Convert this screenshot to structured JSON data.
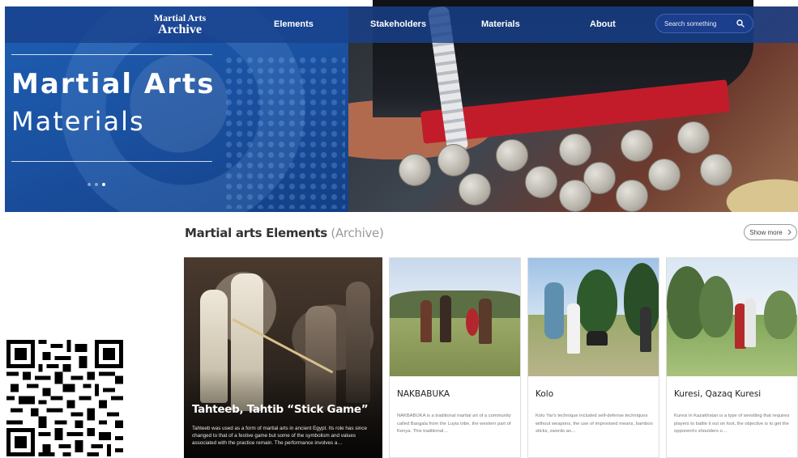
{
  "nav": {
    "logo_line1": "Martial Arts",
    "logo_line2": "Archive",
    "links": [
      "Elements",
      "Stakeholders",
      "Materials",
      "About"
    ],
    "search_placeholder": "Search something"
  },
  "hero": {
    "title_line1": "Martial Arts",
    "title_line2": "Materials",
    "slides": 3,
    "active_slide": 3
  },
  "section": {
    "title_main": "Martial arts Elements",
    "title_sub": "(Archive)",
    "show_more": "Show more"
  },
  "featured": {
    "title": "Tahteeb, Tahtib “Stick Game”",
    "description": "Tahteeb was used as a form of martial arts in ancient Egypt. Its role has since changed to that of a festive game but some of the symbolism and values associated with the practice remain. The performance involves a…"
  },
  "cards": [
    {
      "title": "NAKBABUKA",
      "description": "NAKBABUKA is a traditional martial art of a community called Bangala from the Luyia tribe, the western part of Kenya. This traditional…"
    },
    {
      "title": "Kolo",
      "description": "Kolo Yar's technique included self-defense techniques without weapons, the use of improvised means, bamboo sticks, swords an…"
    },
    {
      "title": "Kuresi, Qazaq Kuresi",
      "description": "Kuresi in Kazakhstan is a type of wrestling that requires players to battle it out on foot, the objective is to get the opponent's shoulders o…"
    }
  ],
  "icons": {
    "search": "search-icon",
    "chevron": "chevron-right-icon"
  },
  "colors": {
    "nav_bg": "#19418c",
    "hero_blue": "#1d5fb3",
    "search_bg": "#1b3f8d"
  }
}
